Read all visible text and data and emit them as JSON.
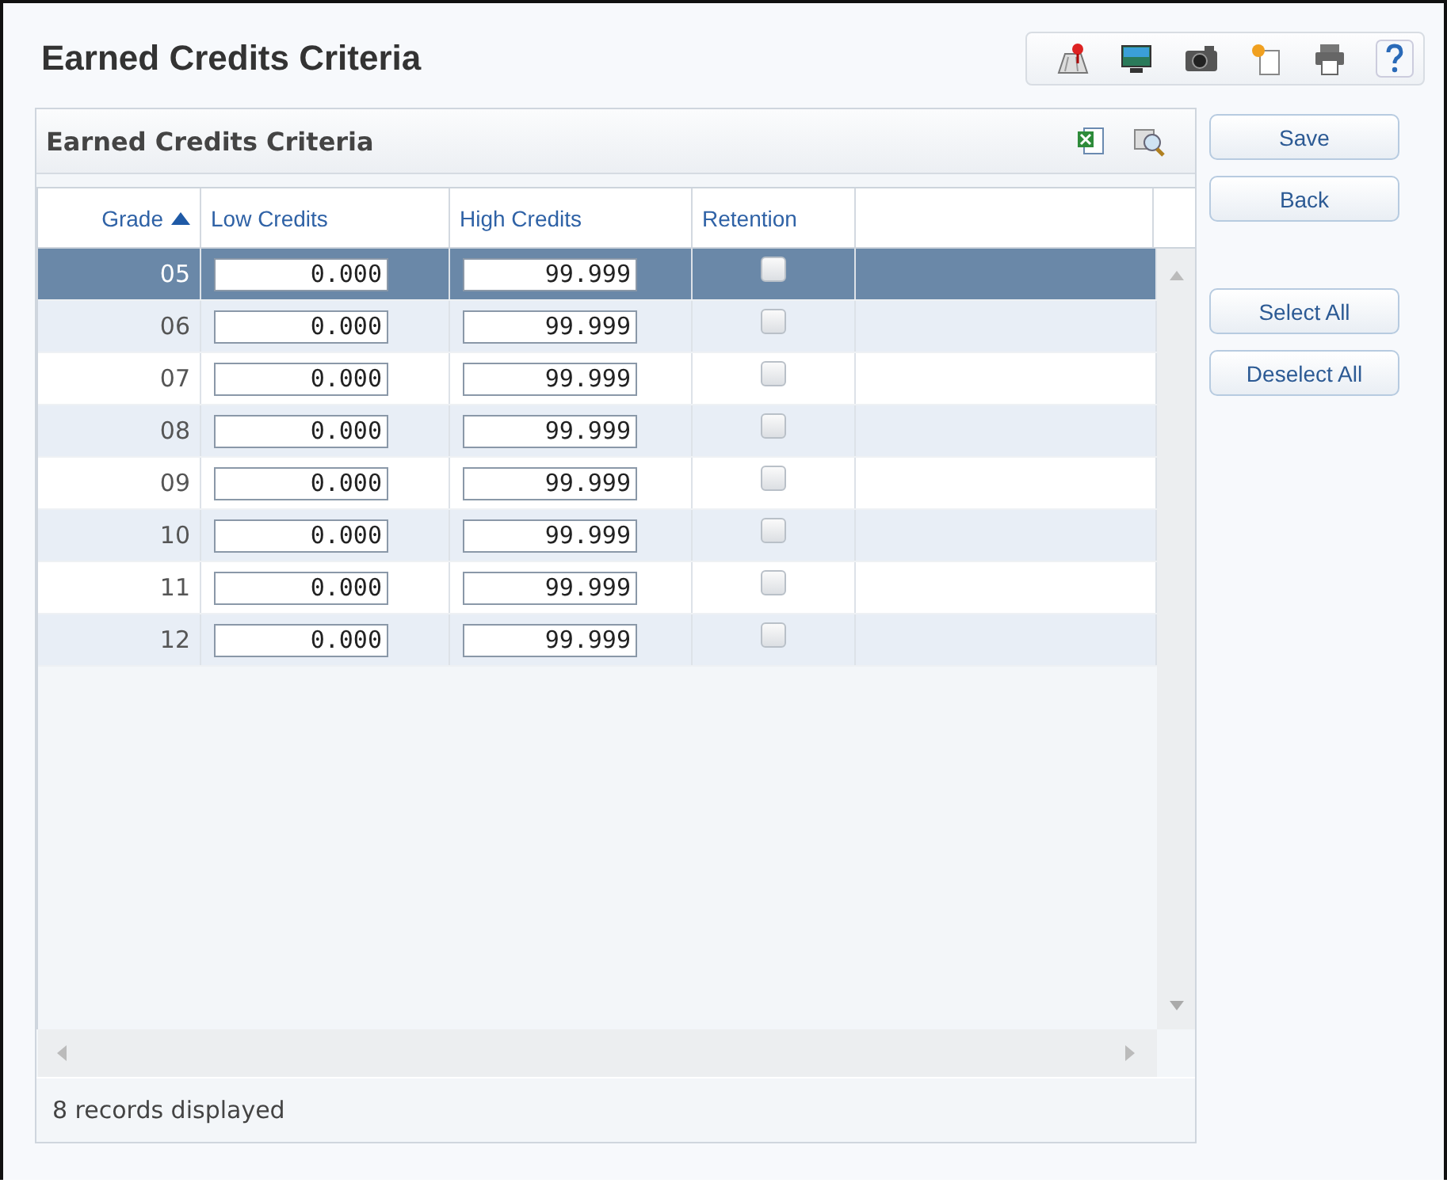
{
  "page_title": "Earned Credits Criteria",
  "panel": {
    "title": "Earned Credits Criteria"
  },
  "table": {
    "columns": [
      {
        "label": "Grade",
        "sorted": true
      },
      {
        "label": "Low Credits",
        "sorted": false
      },
      {
        "label": "High Credits",
        "sorted": false
      },
      {
        "label": "Retention",
        "sorted": false
      }
    ],
    "rows": [
      {
        "grade": "05",
        "low_credits": "0.000",
        "high_credits": "99.999",
        "retention": false,
        "selected": true
      },
      {
        "grade": "06",
        "low_credits": "0.000",
        "high_credits": "99.999",
        "retention": false,
        "selected": false
      },
      {
        "grade": "07",
        "low_credits": "0.000",
        "high_credits": "99.999",
        "retention": false,
        "selected": false
      },
      {
        "grade": "08",
        "low_credits": "0.000",
        "high_credits": "99.999",
        "retention": false,
        "selected": false
      },
      {
        "grade": "09",
        "low_credits": "0.000",
        "high_credits": "99.999",
        "retention": false,
        "selected": false
      },
      {
        "grade": "10",
        "low_credits": "0.000",
        "high_credits": "99.999",
        "retention": false,
        "selected": false
      },
      {
        "grade": "11",
        "low_credits": "0.000",
        "high_credits": "99.999",
        "retention": false,
        "selected": false
      },
      {
        "grade": "12",
        "low_credits": "0.000",
        "high_credits": "99.999",
        "retention": false,
        "selected": false
      }
    ]
  },
  "status_bar": "8 records displayed",
  "buttons": [
    {
      "label": "Save"
    },
    {
      "label": "Back"
    },
    {
      "label": "Select All"
    },
    {
      "label": "Deselect All"
    }
  ]
}
